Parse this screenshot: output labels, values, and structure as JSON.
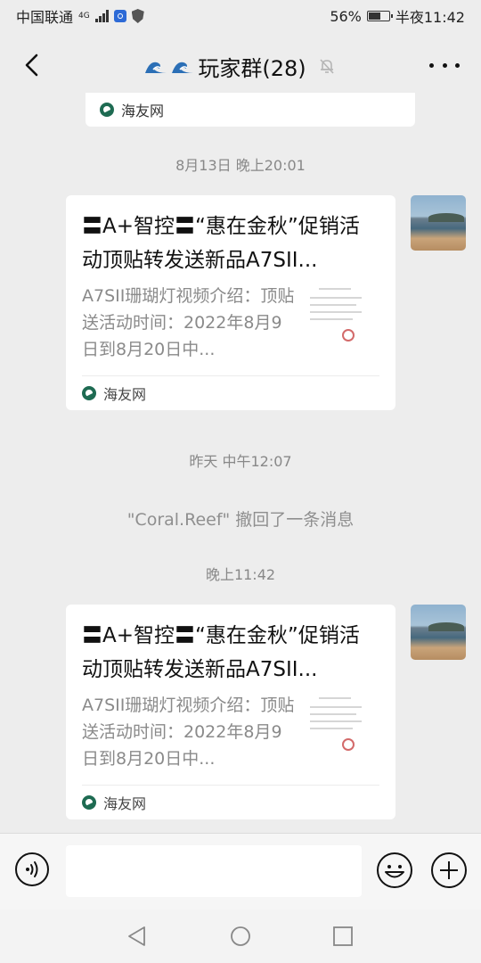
{
  "status_bar": {
    "carrier": "中国联通",
    "network": "4G",
    "battery_percent": "56%",
    "time": "半夜11:42"
  },
  "header": {
    "title": "玩家群(28)",
    "icons": [
      "back-arrow-icon",
      "wave-emoji-icon",
      "mute-bell-icon",
      "more-dots-icon"
    ]
  },
  "chat": {
    "prev_card_source": "海友网",
    "timestamp_1": "8月13日 晚上20:01",
    "message_1": {
      "title": "〓A+智控〓“惠在金秋”促销活动顶贴转发送新品A7SII...",
      "desc": "A7SII珊瑚灯视频介绍：顶贴送活动时间：2022年8月9日到8月20日中...",
      "source": "海友网"
    },
    "timestamp_2": "昨天 中午12:07",
    "recall_text": "\"Coral.Reef\" 撤回了一条消息",
    "timestamp_3": "晚上11:42",
    "message_2": {
      "title": "〓A+智控〓“惠在金秋”促销活动顶贴转发送新品A7SII...",
      "desc": "A7SII珊瑚灯视频介绍：顶贴送活动时间：2022年8月9日到8月20日中...",
      "source": "海友网"
    }
  },
  "input_bar": {
    "placeholder": "",
    "icons": [
      "voice-icon",
      "emoji-icon",
      "plus-icon"
    ]
  },
  "nav_bar": {
    "icons": [
      "nav-back-icon",
      "nav-home-icon",
      "nav-recent-icon"
    ]
  },
  "colors": {
    "background": "#ededed",
    "card": "#ffffff",
    "timestamp": "#888888",
    "source_icon": "#1e6b52"
  }
}
